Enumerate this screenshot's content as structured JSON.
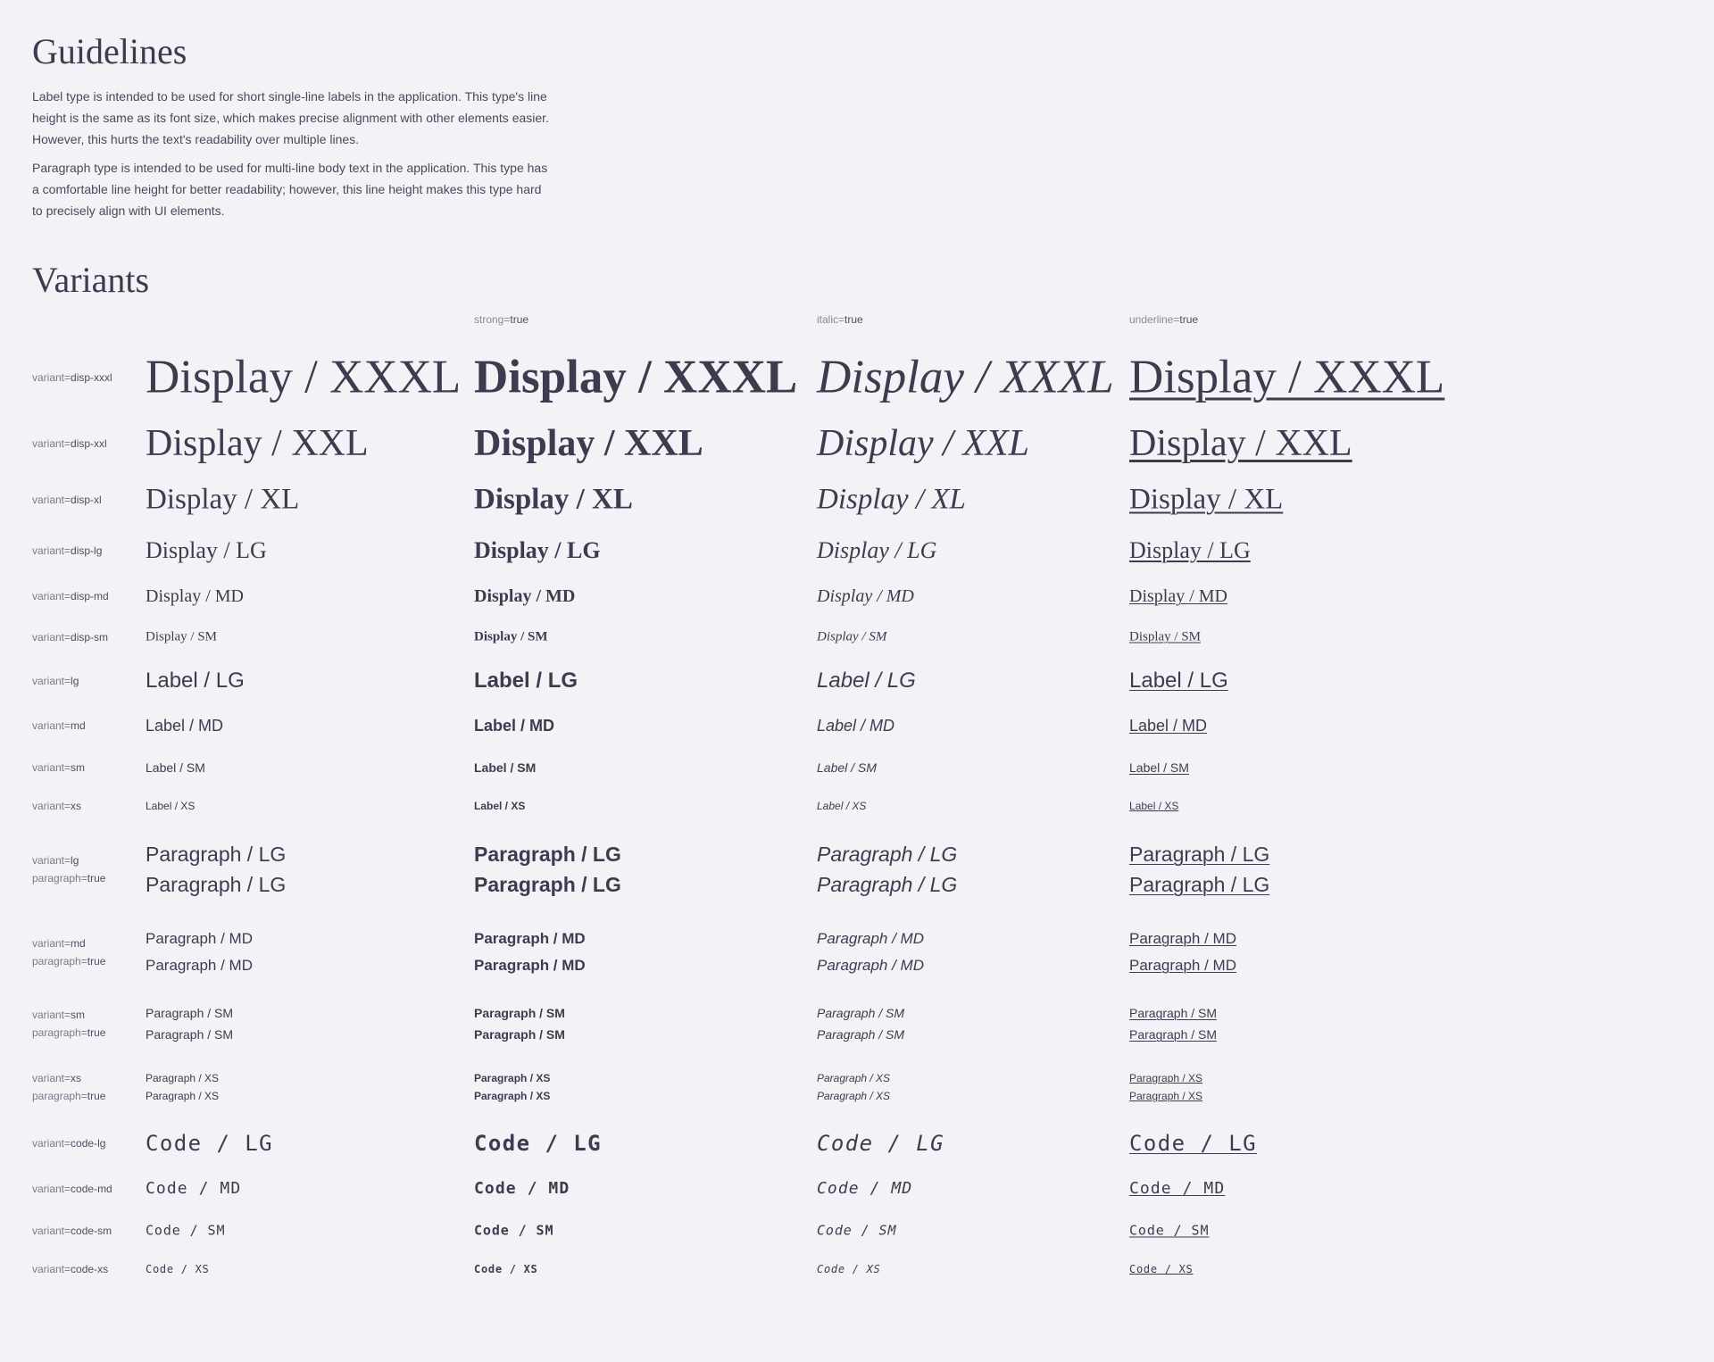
{
  "guidelines": {
    "title": "Guidelines",
    "p1": "Label type is intended to be used for short single-line labels in the application. This type's line height is the same as its font size, which makes precise alignment with other elements easier. However, this hurts the text's readability over multiple lines.",
    "p2": "Paragraph type is intended to be used for multi-line body text in the application. This type has a comfortable line height for better readability; however, this line height makes this type hard to precisely align with UI elements."
  },
  "variants": {
    "title": "Variants",
    "columns": [
      {
        "key": "strong",
        "value": "true"
      },
      {
        "key": "italic",
        "value": "true"
      },
      {
        "key": "underline",
        "value": "true"
      }
    ],
    "eq": "=",
    "rows": [
      {
        "label_key": "variant",
        "label_value": "disp-xxxl",
        "text": "Display / XXXL"
      },
      {
        "label_key": "variant",
        "label_value": "disp-xxl",
        "text": "Display / XXL"
      },
      {
        "label_key": "variant",
        "label_value": "disp-xl",
        "text": "Display / XL"
      },
      {
        "label_key": "variant",
        "label_value": "disp-lg",
        "text": "Display / LG"
      },
      {
        "label_key": "variant",
        "label_value": "disp-md",
        "text": "Display / MD"
      },
      {
        "label_key": "variant",
        "label_value": "disp-sm",
        "text": "Display / SM"
      },
      {
        "label_key": "variant",
        "label_value": "lg",
        "text": "Label / LG"
      },
      {
        "label_key": "variant",
        "label_value": "md",
        "text": "Label / MD"
      },
      {
        "label_key": "variant",
        "label_value": "sm",
        "text": "Label / SM"
      },
      {
        "label_key": "variant",
        "label_value": "xs",
        "text": "Label / XS"
      },
      {
        "label_key": "variant",
        "label_value": "lg",
        "label2_key": "paragraph",
        "label2_value": "true",
        "text": "Paragraph / LG"
      },
      {
        "label_key": "variant",
        "label_value": "md",
        "label2_key": "paragraph",
        "label2_value": "true",
        "text": "Paragraph / MD"
      },
      {
        "label_key": "variant",
        "label_value": "sm",
        "label2_key": "paragraph",
        "label2_value": "true",
        "text": "Paragraph / SM"
      },
      {
        "label_key": "variant",
        "label_value": "xs",
        "label2_key": "paragraph",
        "label2_value": "true",
        "text": "Paragraph / XS"
      },
      {
        "label_key": "variant",
        "label_value": "code-lg",
        "text": "Code / LG"
      },
      {
        "label_key": "variant",
        "label_value": "code-md",
        "text": "Code / MD"
      },
      {
        "label_key": "variant",
        "label_value": "code-sm",
        "text": "Code / SM"
      },
      {
        "label_key": "variant",
        "label_value": "code-xs",
        "text": "Code / XS"
      }
    ]
  }
}
